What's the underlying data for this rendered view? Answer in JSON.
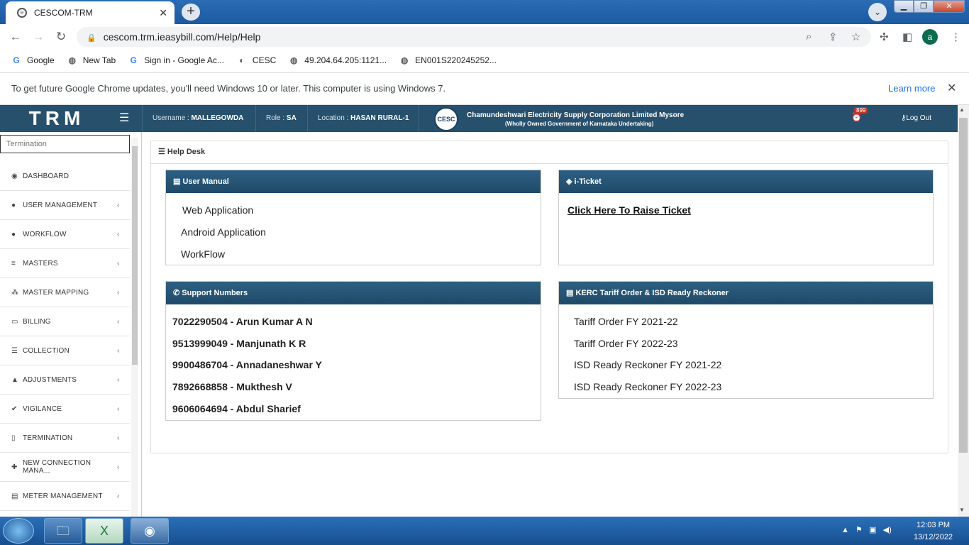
{
  "browser": {
    "tab_title": "CESCOM-TRM",
    "tab_close": "✕",
    "new_tab": "+",
    "url": "cescom.trm.ieasybill.com/Help/Help",
    "profile_initial": "a",
    "bookmarks": [
      {
        "label": "Google",
        "icon": "G"
      },
      {
        "label": "New Tab",
        "icon": "◍"
      },
      {
        "label": "Sign in - Google Ac...",
        "icon": "G"
      },
      {
        "label": "CESC",
        "icon": "◐"
      },
      {
        "label": "49.204.64.205:1121...",
        "icon": "◍"
      },
      {
        "label": "EN001S220245252...",
        "icon": "◍"
      }
    ],
    "infobar_text": "To get future Google Chrome updates, you'll need Windows 10 or later. This computer is using Windows 7.",
    "learn_more": "Learn more",
    "infobar_close": "✕"
  },
  "header": {
    "logo": "TRM",
    "username_label": "Username :",
    "username": "MALLEGOWDA",
    "role_label": "Role :",
    "role": "SA",
    "location_label": "Location :",
    "location": "HASAN RURAL-1",
    "org_name": "Chamundeshwari Electricity Supply Corporation Limited Mysore",
    "org_sub": "(Wholly Owned Government of Karnataka Undertaking)",
    "notification_count": "899",
    "logout": "Log Out"
  },
  "sidebar": {
    "search_placeholder": "Termination",
    "items": [
      {
        "label": "DASHBOARD",
        "icon": "◉",
        "chevron": ""
      },
      {
        "label": "USER MANAGEMENT",
        "icon": "●",
        "chevron": "‹"
      },
      {
        "label": "WORKFLOW",
        "icon": "●",
        "chevron": "‹"
      },
      {
        "label": "MASTERS",
        "icon": "≡",
        "chevron": "‹"
      },
      {
        "label": "MASTER MAPPING",
        "icon": "⁂",
        "chevron": "‹"
      },
      {
        "label": "BILLING",
        "icon": "▭",
        "chevron": "‹"
      },
      {
        "label": "COLLECTION",
        "icon": "☰",
        "chevron": "‹"
      },
      {
        "label": "ADJUSTMENTS",
        "icon": "▲",
        "chevron": "‹"
      },
      {
        "label": "VIGILANCE",
        "icon": "✔",
        "chevron": "‹"
      },
      {
        "label": "TERMINATION",
        "icon": "▯",
        "chevron": "‹"
      },
      {
        "label": "NEW CONNECTION MANA...",
        "icon": "✚",
        "chevron": "‹"
      },
      {
        "label": "METER MANAGEMENT",
        "icon": "▤",
        "chevron": "‹"
      }
    ]
  },
  "helpdesk": {
    "title": "Help Desk",
    "user_manual": {
      "title": "User Manual",
      "links": [
        "Web Application",
        "Android Application",
        "WorkFlow"
      ]
    },
    "iticket": {
      "title": "i-Ticket",
      "link": "Click Here To Raise Ticket"
    },
    "support": {
      "title": "Support Numbers",
      "numbers": [
        "7022290504 - Arun Kumar A N",
        "9513999049 - Manjunath K R",
        "9900486704 - Annadaneshwar Y",
        "7892668858 - Mukthesh V",
        "9606064694 - Abdul Sharief"
      ]
    },
    "kerc": {
      "title": "KERC Tariff Order & ISD Ready Reckoner",
      "links": [
        "Tariff Order FY 2021-22",
        "Tariff Order FY 2022-23",
        "ISD Ready Reckoner FY 2021-22",
        "ISD Ready Reckoner FY 2022-23"
      ]
    }
  },
  "taskbar": {
    "time": "12:03 PM",
    "date": "13/12/2022"
  }
}
